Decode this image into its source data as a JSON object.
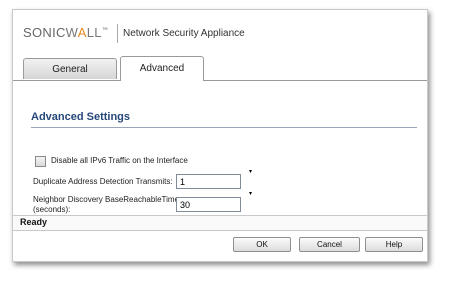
{
  "header": {
    "logo": {
      "sonic": "SONIC",
      "wall_w": "W",
      "wall_a": "A",
      "wall_ll": "LL",
      "tm": "™"
    },
    "product_title": "Network Security Appliance"
  },
  "tabs": [
    {
      "label": "General",
      "active": false
    },
    {
      "label": "Advanced",
      "active": true
    }
  ],
  "section": {
    "title": "Advanced Settings"
  },
  "form": {
    "disable_ipv6": {
      "label": "Disable all IPv6 Traffic on the Interface",
      "checked": false
    },
    "dad_transmits": {
      "label": "Duplicate Address Detection Transmits:",
      "value": "1"
    },
    "nd_reachable": {
      "label_line1": "Neighbor Discovery BaseReachableTime",
      "label_line2": "(seconds):",
      "value": "30"
    },
    "required_marker": "▾"
  },
  "status": {
    "text": "Ready"
  },
  "buttons": {
    "ok": "OK",
    "cancel": "Cancel",
    "help": "Help"
  },
  "colors": {
    "accent": "#e68a1e",
    "section_title": "#26477a"
  }
}
